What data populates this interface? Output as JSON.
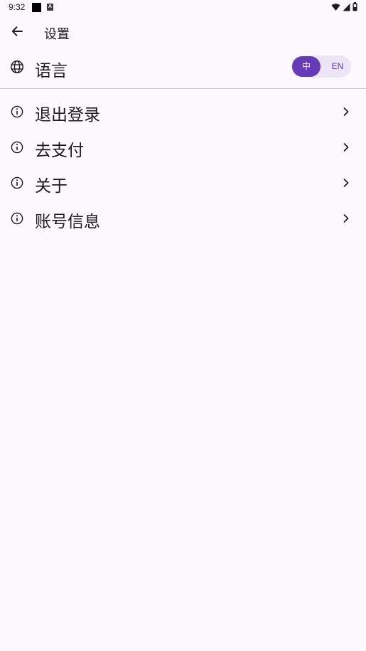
{
  "status_bar": {
    "time": "9:32"
  },
  "app_bar": {
    "title": "设置",
    "back_icon": "arrow-back-icon"
  },
  "language": {
    "label": "语言",
    "icon": "globe-icon",
    "options": [
      "中",
      "EN"
    ],
    "selected": "中"
  },
  "menu": {
    "items": [
      {
        "label": "退出登录",
        "icon": "info-icon"
      },
      {
        "label": "去支付",
        "icon": "info-icon"
      },
      {
        "label": "关于",
        "icon": "info-icon"
      },
      {
        "label": "账号信息",
        "icon": "info-icon"
      }
    ]
  },
  "colors": {
    "background": "#fdf7fe",
    "accent": "#673ab7",
    "toggle_track": "#ece5f6",
    "divider": "#c8c4cc"
  }
}
